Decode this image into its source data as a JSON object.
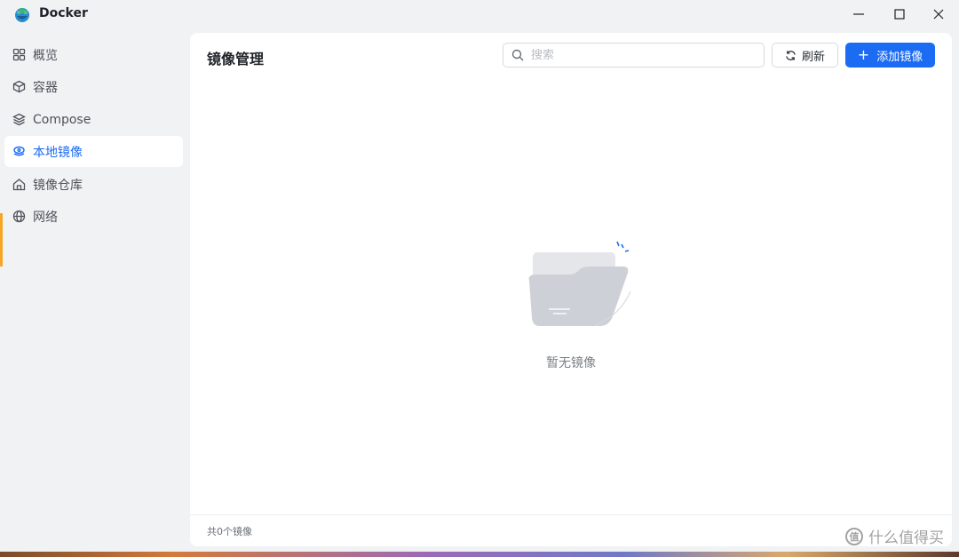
{
  "window": {
    "title": "Docker"
  },
  "sidebar": {
    "items": [
      {
        "label": "概览",
        "icon": "grid-icon"
      },
      {
        "label": "容器",
        "icon": "cube-icon"
      },
      {
        "label": "Compose",
        "icon": "layers-icon"
      },
      {
        "label": "本地镜像",
        "icon": "disk-stack-icon",
        "active": true
      },
      {
        "label": "镜像仓库",
        "icon": "house-icon"
      },
      {
        "label": "网络",
        "icon": "globe-icon"
      }
    ]
  },
  "main": {
    "title": "镜像管理",
    "search_placeholder": "搜索",
    "refresh_label": "刷新",
    "add_label": "添加镜像",
    "empty_text": "暂无镜像",
    "footer_text": "共0个镜像"
  },
  "watermark": {
    "text": "什么值得买",
    "logo_text": "值"
  },
  "colors": {
    "accent": "#1b6cf2",
    "sidebar_bg": "#f1f2f4",
    "panel_bg": "#ffffff",
    "orange_marker": "#f5a623"
  }
}
